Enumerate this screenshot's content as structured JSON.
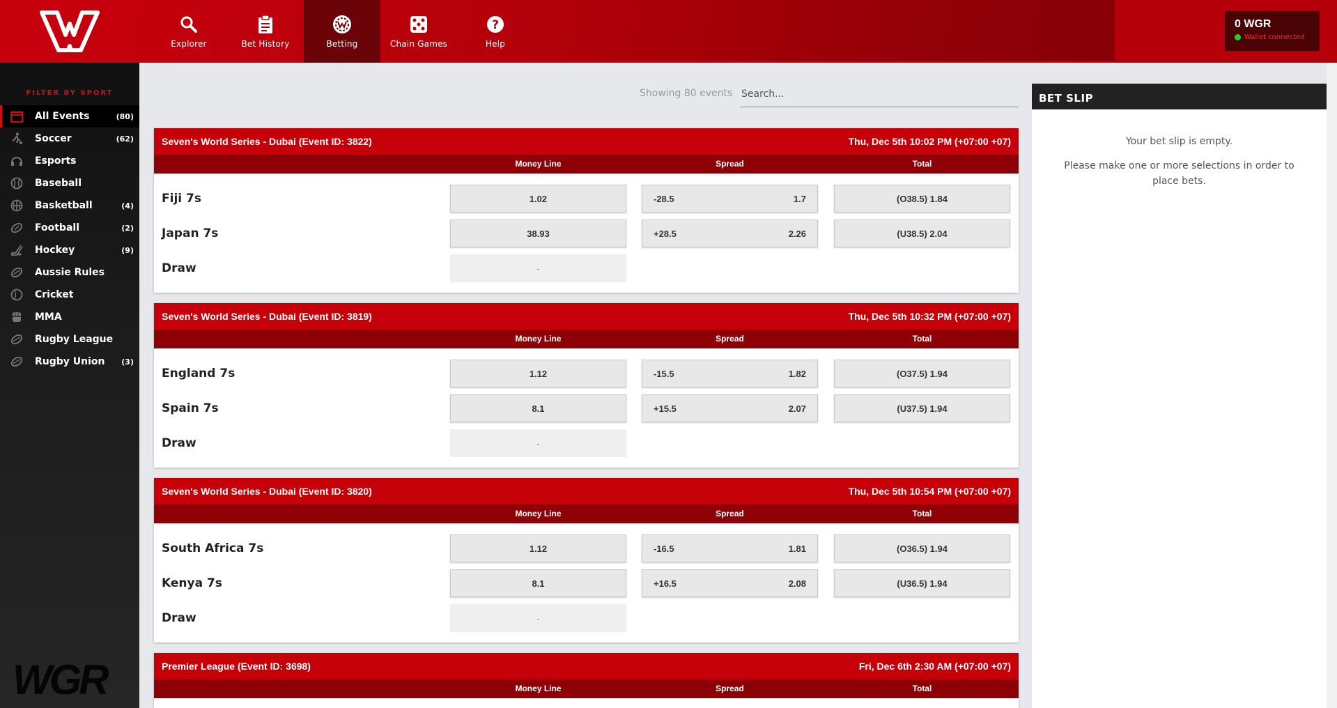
{
  "header": {
    "nav": [
      {
        "label": "Explorer",
        "icon": "search-icon"
      },
      {
        "label": "Bet History",
        "icon": "clipboard-icon"
      },
      {
        "label": "Betting",
        "icon": "betting-chip-icon",
        "active": true
      },
      {
        "label": "Chain Games",
        "icon": "dice-icon"
      },
      {
        "label": "Help",
        "icon": "help-icon"
      }
    ],
    "wallet_balance": "0 WGR",
    "wallet_status": "Wallet connected"
  },
  "sidebar": {
    "title": "FILTER BY SPORT",
    "items": [
      {
        "label": "All Events",
        "count": "(80)",
        "icon": "calendar-icon"
      },
      {
        "label": "Soccer",
        "count": "(62)",
        "icon": "soccer-player-icon"
      },
      {
        "label": "Esports",
        "count": "",
        "icon": "headset-icon"
      },
      {
        "label": "Baseball",
        "count": "",
        "icon": "baseball-icon"
      },
      {
        "label": "Basketball",
        "count": "(4)",
        "icon": "basketball-icon"
      },
      {
        "label": "Football",
        "count": "(2)",
        "icon": "football-icon"
      },
      {
        "label": "Hockey",
        "count": "(9)",
        "icon": "hockey-icon"
      },
      {
        "label": "Aussie Rules",
        "count": "",
        "icon": "aussie-ball-icon"
      },
      {
        "label": "Cricket",
        "count": "",
        "icon": "cricket-ball-icon"
      },
      {
        "label": "MMA",
        "count": "",
        "icon": "mma-icon"
      },
      {
        "label": "Rugby League",
        "count": "",
        "icon": "rugby-ball-icon"
      },
      {
        "label": "Rugby Union",
        "count": "(3)",
        "icon": "rugby-ball-icon"
      }
    ],
    "brand": "WGR"
  },
  "main": {
    "showing": "Showing 80 events",
    "search_placeholder": "Search...",
    "columns": {
      "moneyline": "Money Line",
      "spread": "Spread",
      "total": "Total"
    },
    "events": [
      {
        "title": "Seven's World Series - Dubai (Event ID: 3822)",
        "time": "Thu, Dec 5th 10:02 PM (+07:00 +07)",
        "home": {
          "team": "Fiji 7s",
          "ml": "1.02",
          "spread_line": "-28.5",
          "spread_odds": "1.7",
          "total": "(O38.5) 1.84"
        },
        "away": {
          "team": "Japan 7s",
          "ml": "38.93",
          "spread_line": "+28.5",
          "spread_odds": "2.26",
          "total": "(U38.5) 2.04"
        },
        "draw": {
          "team": "Draw",
          "ml": "-"
        }
      },
      {
        "title": "Seven's World Series - Dubai (Event ID: 3819)",
        "time": "Thu, Dec 5th 10:32 PM (+07:00 +07)",
        "home": {
          "team": "England 7s",
          "ml": "1.12",
          "spread_line": "-15.5",
          "spread_odds": "1.82",
          "total": "(O37.5) 1.94"
        },
        "away": {
          "team": "Spain 7s",
          "ml": "8.1",
          "spread_line": "+15.5",
          "spread_odds": "2.07",
          "total": "(U37.5) 1.94"
        },
        "draw": {
          "team": "Draw",
          "ml": "-"
        }
      },
      {
        "title": "Seven's World Series - Dubai (Event ID: 3820)",
        "time": "Thu, Dec 5th 10:54 PM (+07:00 +07)",
        "home": {
          "team": "South Africa 7s",
          "ml": "1.12",
          "spread_line": "-16.5",
          "spread_odds": "1.81",
          "total": "(O36.5) 1.94"
        },
        "away": {
          "team": "Kenya 7s",
          "ml": "8.1",
          "spread_line": "+16.5",
          "spread_odds": "2.08",
          "total": "(U36.5) 1.94"
        },
        "draw": {
          "team": "Draw",
          "ml": "-"
        }
      },
      {
        "title": "Premier League (Event ID: 3698)",
        "time": "Fri, Dec 6th 2:30 AM (+07:00 +07)"
      }
    ]
  },
  "betslip": {
    "title": "BET SLIP",
    "empty": "Your bet slip is empty.",
    "help": "Please make one or more selections in order to place bets."
  }
}
